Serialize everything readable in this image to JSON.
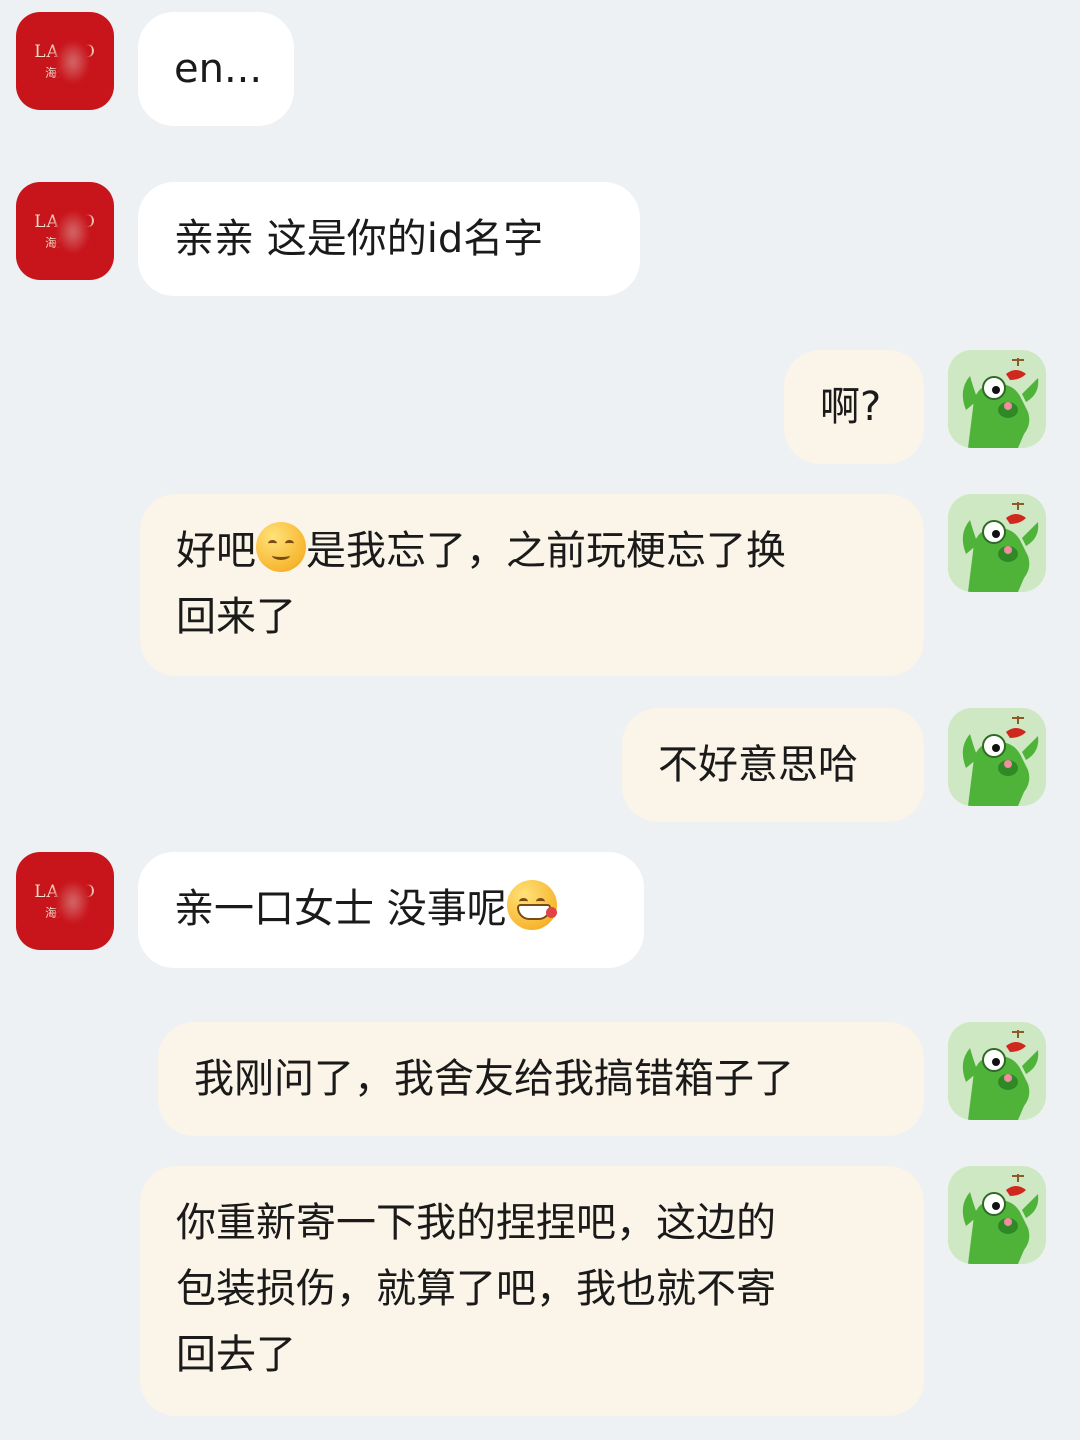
{
  "store_avatar": {
    "brand": "LA DO",
    "subtitle": "海外 店"
  },
  "messages": [
    {
      "side": "in",
      "text": "en..."
    },
    {
      "side": "in",
      "text": "亲亲 这是你的id名字"
    },
    {
      "side": "out",
      "text": "啊?"
    },
    {
      "side": "out",
      "before": "好吧",
      "emoji": "disappointed-face-emoji",
      "after": "是我忘了，之前玩梗忘了换",
      "line2": "回来了"
    },
    {
      "side": "out",
      "text": "不好意思哈"
    },
    {
      "side": "in",
      "before": "亲一口女士 没事呢",
      "emoji": "grinning-squint-face-emoji"
    },
    {
      "side": "out",
      "text": "我刚问了，我舍友给我搞错箱子了"
    },
    {
      "side": "out",
      "line1": "你重新寄一下我的捏捏吧，这边的",
      "line2": "包装损伤，就算了吧，我也就不寄",
      "line3": "回去了"
    }
  ],
  "colors": {
    "background": "#eef1f4",
    "incoming_bubble": "#ffffff",
    "outgoing_bubble": "#fbf4e8",
    "store_avatar": "#c8141b",
    "user_avatar": "#cde8c2"
  }
}
